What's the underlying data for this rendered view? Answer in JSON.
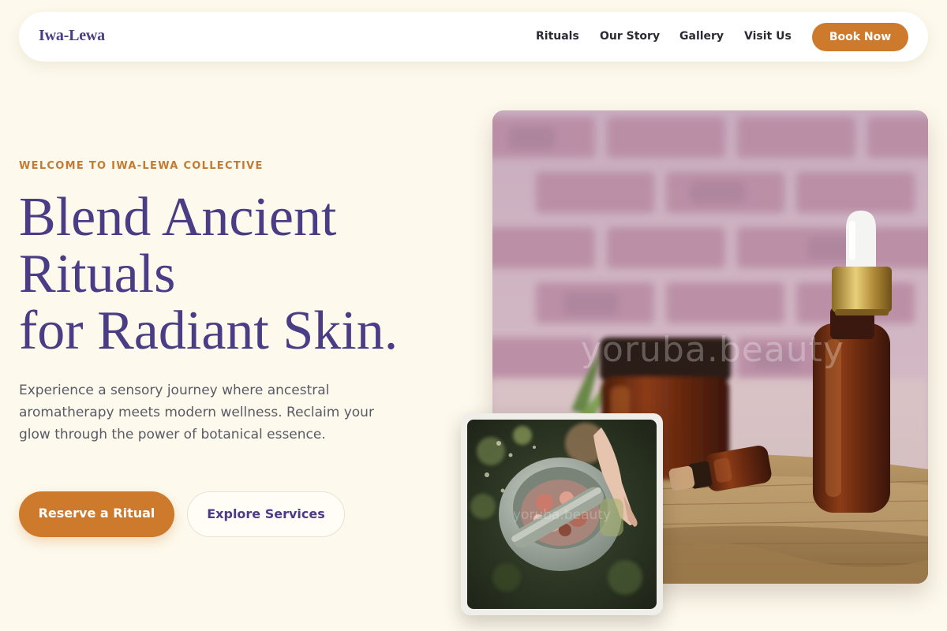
{
  "header": {
    "brand": "Iwa-Lewa",
    "nav": [
      "Rituals",
      "Our Story",
      "Gallery",
      "Visit Us"
    ],
    "cta": "Book Now"
  },
  "hero": {
    "eyebrow": "WELCOME TO IWA-LEWA COLLECTIVE",
    "title_lines": [
      "Blend Ancient",
      "Rituals",
      "for Radiant Skin."
    ],
    "description": "Experience a sensory journey where ancestral aromatherapy meets modern wellness. Reclaim your glow through the power of botanical essence.",
    "primary_button": "Reserve a Ritual",
    "secondary_button": "Explore Services"
  },
  "images": {
    "main_watermark": "yoruba.beauty",
    "inset_watermark": "yoruba.beauty"
  },
  "colors": {
    "background": "#fdf9ec",
    "brand_purple": "#4a3d86",
    "accent_orange": "#cd7a2c"
  }
}
